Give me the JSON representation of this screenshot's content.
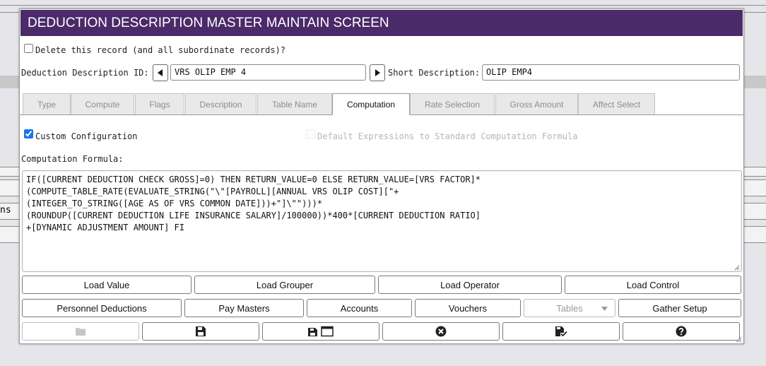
{
  "background": {
    "fragment_1": "ns"
  },
  "dialog": {
    "title": "DEDUCTION DESCRIPTION MASTER MAINTAIN SCREEN",
    "delete_label": "Delete this record (and all subordinate records)?",
    "id_label": "Deduction Description ID:",
    "id_value": "VRS OLIP EMP 4",
    "short_desc_label": "Short Description:",
    "short_desc_value": "OLIP EMP4",
    "tabs": [
      {
        "label": "Type"
      },
      {
        "label": "Compute"
      },
      {
        "label": "Flags"
      },
      {
        "label": "Description"
      },
      {
        "label": "Table Name"
      },
      {
        "label": "Computation",
        "active": true
      },
      {
        "label": "Rate Selection"
      },
      {
        "label": "Gross Amount"
      },
      {
        "label": "Affect Select"
      }
    ],
    "custom_config_label": "Custom Configuration",
    "custom_config_checked": true,
    "default_expr_label": "Default Expressions to Standard Computation Formula",
    "formula_label": "Computation Formula:",
    "formula_value": "IF([CURRENT DEDUCTION CHECK GROSS]=0) THEN RETURN_VALUE=0 ELSE RETURN_VALUE=[VRS FACTOR]*\n(COMPUTE_TABLE_RATE(EVALUATE_STRING(\"\\\"[PAYROLL][ANNUAL VRS OLIP COST][\"+\n(INTEGER_TO_STRING([AGE AS OF VRS COMMON DATE]))+\"]\\\"\")))*\n(ROUNDUP([CURRENT DEDUCTION LIFE INSURANCE SALARY]/100000))*400*[CURRENT DEDUCTION RATIO]\n+[DYNAMIC ADJUSTMENT AMOUNT] FI",
    "load_buttons": {
      "value": "Load Value",
      "grouper": "Load Grouper",
      "operator": "Load Operator",
      "control": "Load Control"
    },
    "nav_buttons": {
      "personnel": "Personnel Deductions",
      "pay_masters": "Pay Masters",
      "accounts": "Accounts",
      "vouchers": "Vouchers",
      "tables": "Tables",
      "gather": "Gather Setup"
    },
    "icons": {
      "folder": "folder-icon",
      "save": "save-icon",
      "save_window": "save-window-icon",
      "close": "close-circle-icon",
      "save_check": "save-check-icon",
      "help": "help-icon"
    },
    "accent_color": "#4b2a6a"
  }
}
